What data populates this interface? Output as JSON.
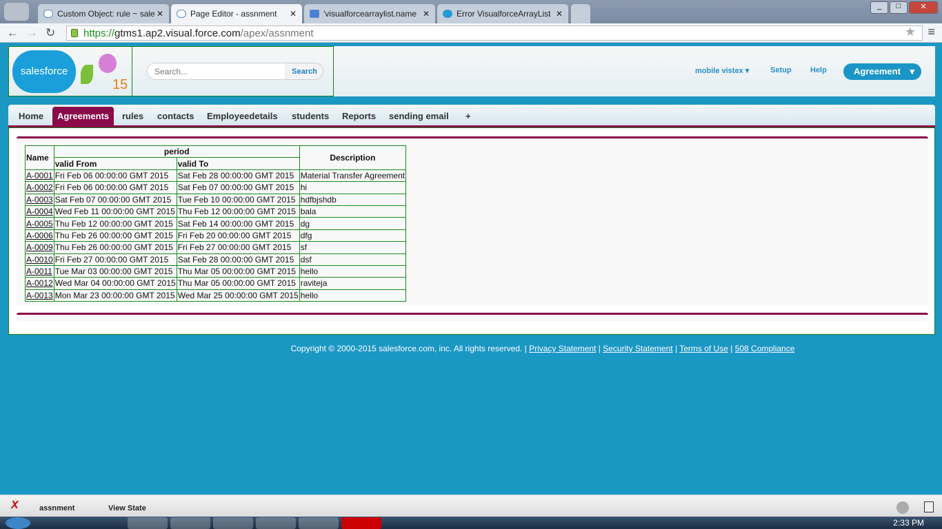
{
  "browser": {
    "tabs": [
      {
        "label": "Custom Object: rule ~ sale"
      },
      {
        "label": "Page Editor - assnment"
      },
      {
        "label": "'visualforcearraylist.name"
      },
      {
        "label": "Error VisualforceArrayList"
      }
    ],
    "url_scheme": "https://",
    "url_host": "gtms1.ap2.visual.force.com",
    "url_path": "/apex/assnment"
  },
  "header": {
    "logo": "salesforce",
    "logo_badge": "15",
    "search_placeholder": "Search...",
    "search_button": "Search",
    "user_menu": "mobile vistex",
    "setup": "Setup",
    "help": "Help",
    "app_menu": "Agreement"
  },
  "nav": {
    "tabs": [
      "Home",
      "Agreements",
      "rules",
      "contacts",
      "Employeedetails",
      "students",
      "Reports",
      "sending email",
      "+"
    ],
    "active": "Agreements"
  },
  "table": {
    "headers": {
      "name": "Name",
      "period": "period",
      "valid_from": "valid From",
      "valid_to": "valid To",
      "description": "Description"
    },
    "rows": [
      [
        "A-0001",
        "Fri Feb 06 00:00:00 GMT 2015",
        "Sat Feb 28 00:00:00 GMT 2015",
        "Material Transfer Agreement"
      ],
      [
        "A-0002",
        "Fri Feb 06 00:00:00 GMT 2015",
        "Sat Feb 07 00:00:00 GMT 2015",
        "hi"
      ],
      [
        "A-0003",
        "Sat Feb 07 00:00:00 GMT 2015",
        "Tue Feb 10 00:00:00 GMT 2015",
        "hdfbjshdb"
      ],
      [
        "A-0004",
        "Wed Feb 11 00:00:00 GMT 2015",
        "Thu Feb 12 00:00:00 GMT 2015",
        "bala"
      ],
      [
        "A-0005",
        "Thu Feb 12 00:00:00 GMT 2015",
        "Sat Feb 14 00:00:00 GMT 2015",
        "dg"
      ],
      [
        "A-0006",
        "Thu Feb 26 00:00:00 GMT 2015",
        "Fri Feb 20 00:00:00 GMT 2015",
        "dfg"
      ],
      [
        "A-0009",
        "Thu Feb 26 00:00:00 GMT 2015",
        "Fri Feb 27 00:00:00 GMT 2015",
        "sf"
      ],
      [
        "A-0010",
        "Fri Feb 27 00:00:00 GMT 2015",
        "Sat Feb 28 00:00:00 GMT 2015",
        "dsf"
      ],
      [
        "A-0011",
        "Tue Mar 03 00:00:00 GMT 2015",
        "Thu Mar 05 00:00:00 GMT 2015",
        "hello"
      ],
      [
        "A-0012",
        "Wed Mar 04 00:00:00 GMT 2015",
        "Thu Mar 05 00:00:00 GMT 2015",
        "raviteja"
      ],
      [
        "A-0013",
        "Mon Mar 23 00:00:00 GMT 2015",
        "Wed Mar 25 00:00:00 GMT 2015",
        "hello"
      ]
    ]
  },
  "footer": {
    "copyright": "Copyright © 2000-2015 salesforce.com, inc. All rights reserved. |",
    "links": [
      "Privacy Statement",
      "Security Statement",
      "Terms of Use",
      "508 Compliance"
    ]
  },
  "devbar": {
    "page": "assnment",
    "view_state": "View State"
  },
  "taskbar": {
    "clock": "2:33 PM"
  }
}
